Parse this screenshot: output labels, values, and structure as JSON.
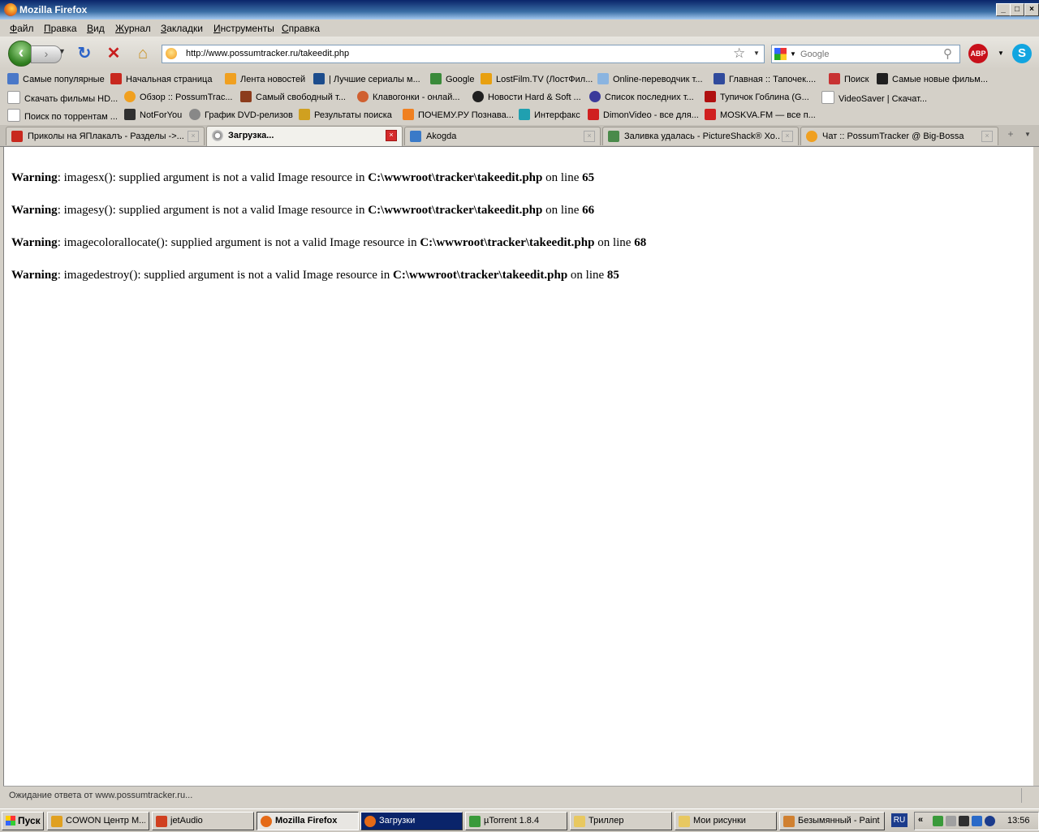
{
  "window": {
    "title": "Mozilla Firefox",
    "min": "_",
    "max": "□",
    "close": "×"
  },
  "menu": [
    "Файл",
    "Правка",
    "Вид",
    "Журнал",
    "Закладки",
    "Инструменты",
    "Справка"
  ],
  "nav": {
    "url": "http://www.possumtracker.ru/takeedit.php",
    "search_placeholder": "Google",
    "abp": "ABP"
  },
  "bookmarks_row1": [
    {
      "label": "Самые популярные",
      "color": "#4a78c8"
    },
    {
      "label": "Начальная страница",
      "color": "#c8281e"
    },
    {
      "label": "Лента новостей",
      "color": "#f0a020"
    },
    {
      "label": "| Лучшие сериалы м...",
      "color": "#1c4c8c"
    },
    {
      "label": "Google",
      "color": "#3a8a3a"
    },
    {
      "label": "LostFilm.TV (ЛостФил...",
      "color": "#e8a010"
    },
    {
      "label": "Online-переводчик т...",
      "color": "#8ab4e0"
    },
    {
      "label": "Главная :: Тапочек....",
      "color": "#304a9c"
    },
    {
      "label": "Поиск",
      "color": "#c83232"
    },
    {
      "label": "Самые новые фильм...",
      "color": "#202020"
    }
  ],
  "bookmarks_row2": [
    {
      "label": "Скачать фильмы HD...",
      "color": "#ffffff"
    },
    {
      "label": "Обзор :: PossumTrac...",
      "color": "#f0a020"
    },
    {
      "label": "Самый свободный т...",
      "color": "#8c3c1c"
    },
    {
      "label": "Клавогонки - онлай...",
      "color": "#d06030"
    },
    {
      "label": "Новости Hard & Soft ...",
      "color": "#202020"
    },
    {
      "label": "Список последних т...",
      "color": "#3a3a9a"
    },
    {
      "label": "Тупичок Гоблина (G...",
      "color": "#b01010"
    },
    {
      "label": "VideoSaver | Скачат...",
      "color": "#ffffff"
    }
  ],
  "bookmarks_row3": [
    {
      "label": "Поиск по торрентам ...",
      "color": "#ffffff"
    },
    {
      "label": "NotForYou",
      "color": "#303030"
    },
    {
      "label": "График DVD-релизов",
      "color": "#888888"
    },
    {
      "label": "Результаты поиска",
      "color": "#d0a020"
    },
    {
      "label": "ПОЧЕМУ.РУ Познава...",
      "color": "#f08020"
    },
    {
      "label": "Интерфакс",
      "color": "#20a0b0"
    },
    {
      "label": "DimonVideo - все для...",
      "color": "#d02020"
    },
    {
      "label": "MOSKVA.FM — все п...",
      "color": "#d02020"
    }
  ],
  "tabs": [
    {
      "label": "Приколы на ЯПлакалъ - Разделы ->...",
      "color": "#c8281e",
      "close": "×"
    },
    {
      "label": "Загрузка...",
      "color": "#888888",
      "close": "×"
    },
    {
      "label": "Akogda",
      "color": "#3a7ac8",
      "close": "×"
    },
    {
      "label": "Заливка удалась - PictureShack® Хо...",
      "color": "#4a8a4a",
      "close": "×"
    },
    {
      "label": "Чат :: PossumTracker @ Big-Bossa",
      "color": "#f0a020",
      "close": "×"
    }
  ],
  "warnings": [
    {
      "label": "Warning",
      "msg": ": imagesx(): supplied argument is not a valid Image resource in ",
      "file": "C:\\wwwroot\\tracker\\takeedit.php",
      "online": " on line ",
      "line": "65"
    },
    {
      "label": "Warning",
      "msg": ": imagesy(): supplied argument is not a valid Image resource in ",
      "file": "C:\\wwwroot\\tracker\\takeedit.php",
      "online": " on line ",
      "line": "66"
    },
    {
      "label": "Warning",
      "msg": ": imagecolorallocate(): supplied argument is not a valid Image resource in ",
      "file": "C:\\wwwroot\\tracker\\takeedit.php",
      "online": " on line ",
      "line": "68"
    },
    {
      "label": "Warning",
      "msg": ": imagedestroy(): supplied argument is not a valid Image resource in ",
      "file": "C:\\wwwroot\\tracker\\takeedit.php",
      "online": " on line ",
      "line": "85"
    }
  ],
  "status": "Ожидание ответа от www.possumtracker.ru...",
  "taskbar": {
    "start": "Пуск",
    "items": [
      {
        "label": "COWON Центр М...",
        "color": "#e0a020"
      },
      {
        "label": "jetAudio",
        "color": "#d04020"
      },
      {
        "label": "Mozilla Firefox",
        "color": "#e56a17"
      },
      {
        "label": "Загрузки",
        "color": "#e56a17"
      },
      {
        "label": "µTorrent 1.8.4",
        "color": "#3a9a3a"
      },
      {
        "label": "Триллер",
        "color": "#e8c860"
      },
      {
        "label": "Мои рисунки",
        "color": "#e8c860"
      },
      {
        "label": "Безымянный - Paint",
        "color": "#d08030"
      }
    ],
    "lang": "RU",
    "chev": "«",
    "clock": "13:56"
  }
}
